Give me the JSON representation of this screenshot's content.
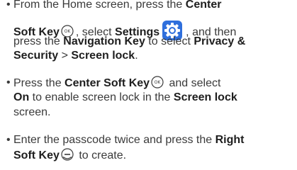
{
  "steps": [
    {
      "bullet": "•",
      "line1_a": "From the Home screen, press the ",
      "line1_b": "Center",
      "line2_a": "Soft Key",
      "line2_b": ", select ",
      "line2_c": "Settings",
      "line2_d": ", and then",
      "line3_a": "press the ",
      "line3_b": "Navigation Key",
      "line3_c": " to select ",
      "line3_d": "Privacy &",
      "line4_a": "Security",
      "line4_b": " > ",
      "line4_c": "Screen lock",
      "line4_d": ".",
      "icons": [
        "center-soft-key-icon",
        "settings-gear-icon"
      ]
    },
    {
      "bullet": "•",
      "line1_a": "Press the ",
      "line1_b": "Center Soft Key",
      "line1_c": " and select",
      "line2_a": "On",
      "line2_b": " to enable screen lock in the ",
      "line2_c": "Screen lock",
      "line3_a": "screen.",
      "icons": [
        "center-soft-key-icon"
      ]
    },
    {
      "bullet": "•",
      "line1_a": "Enter the passcode twice and press the ",
      "line1_b": "Right",
      "line2_a": "Soft Key",
      "line2_b": " to create.",
      "icons": [
        "right-soft-key-icon"
      ]
    }
  ],
  "colors": {
    "text": "#3a3a3a",
    "bold_text": "#1e1e1e",
    "settings_icon": "#2f6fdc"
  }
}
